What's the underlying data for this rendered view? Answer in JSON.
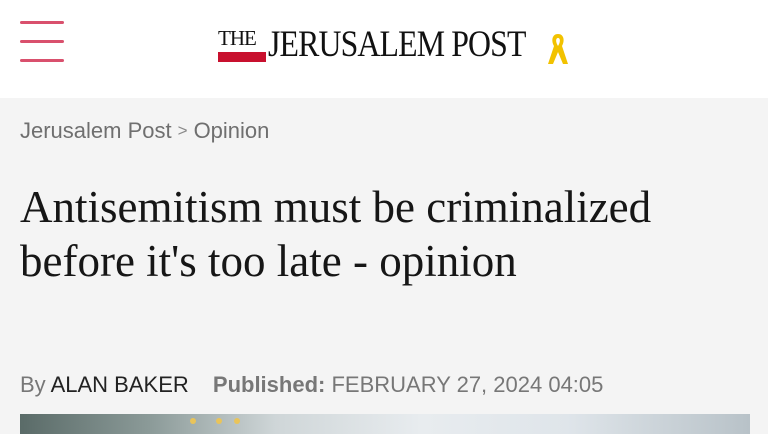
{
  "header": {
    "menu_icon": "hamburger-menu-icon",
    "logo": {
      "the": "THE",
      "name": "JERUSALEM POST",
      "ribbon_icon": "yellow-ribbon-icon"
    },
    "colors": {
      "menu": "#d9506d",
      "logo_red": "#c8102e",
      "ribbon": "#f2c200"
    }
  },
  "breadcrumb": {
    "items": [
      "Jerusalem Post",
      "Opinion"
    ],
    "separator": ">"
  },
  "article": {
    "title": "Antisemitism must be criminalized before it's too late - opinion",
    "byline": {
      "prefix": "By",
      "author": "ALAN BAKER",
      "published_label": "Published:",
      "published_date": "FEBRUARY 27, 2024 04:05"
    }
  }
}
